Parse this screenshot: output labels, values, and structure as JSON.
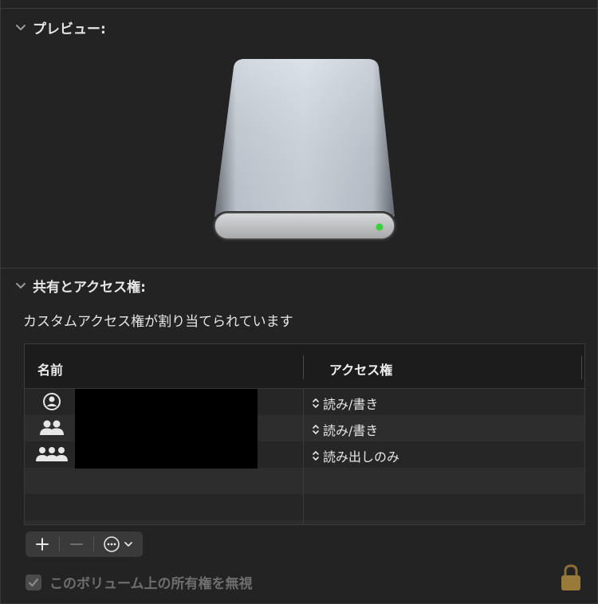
{
  "preview": {
    "title": "プレビュー:"
  },
  "sharing": {
    "title": "共有とアクセス権:",
    "subtitle": "カスタムアクセス権が割り当てられています",
    "table": {
      "columns": [
        "名前",
        "アクセス権"
      ],
      "rows": [
        {
          "icon": "person-icon",
          "name": "",
          "access": "読み/書き"
        },
        {
          "icon": "group-icon",
          "name": "",
          "access": "読み/書き"
        },
        {
          "icon": "everyone-icon",
          "name": "",
          "access": "読み出しのみ"
        },
        {
          "icon": "",
          "name": "",
          "access": ""
        },
        {
          "icon": "",
          "name": "",
          "access": ""
        }
      ]
    },
    "ignore_ownership": {
      "label": "このボリューム上の所有権を無視",
      "checked": true,
      "enabled": false
    }
  },
  "colors": {
    "background": "#232323",
    "status_led": "#3bd13b",
    "lock": "#9a7a3a"
  }
}
